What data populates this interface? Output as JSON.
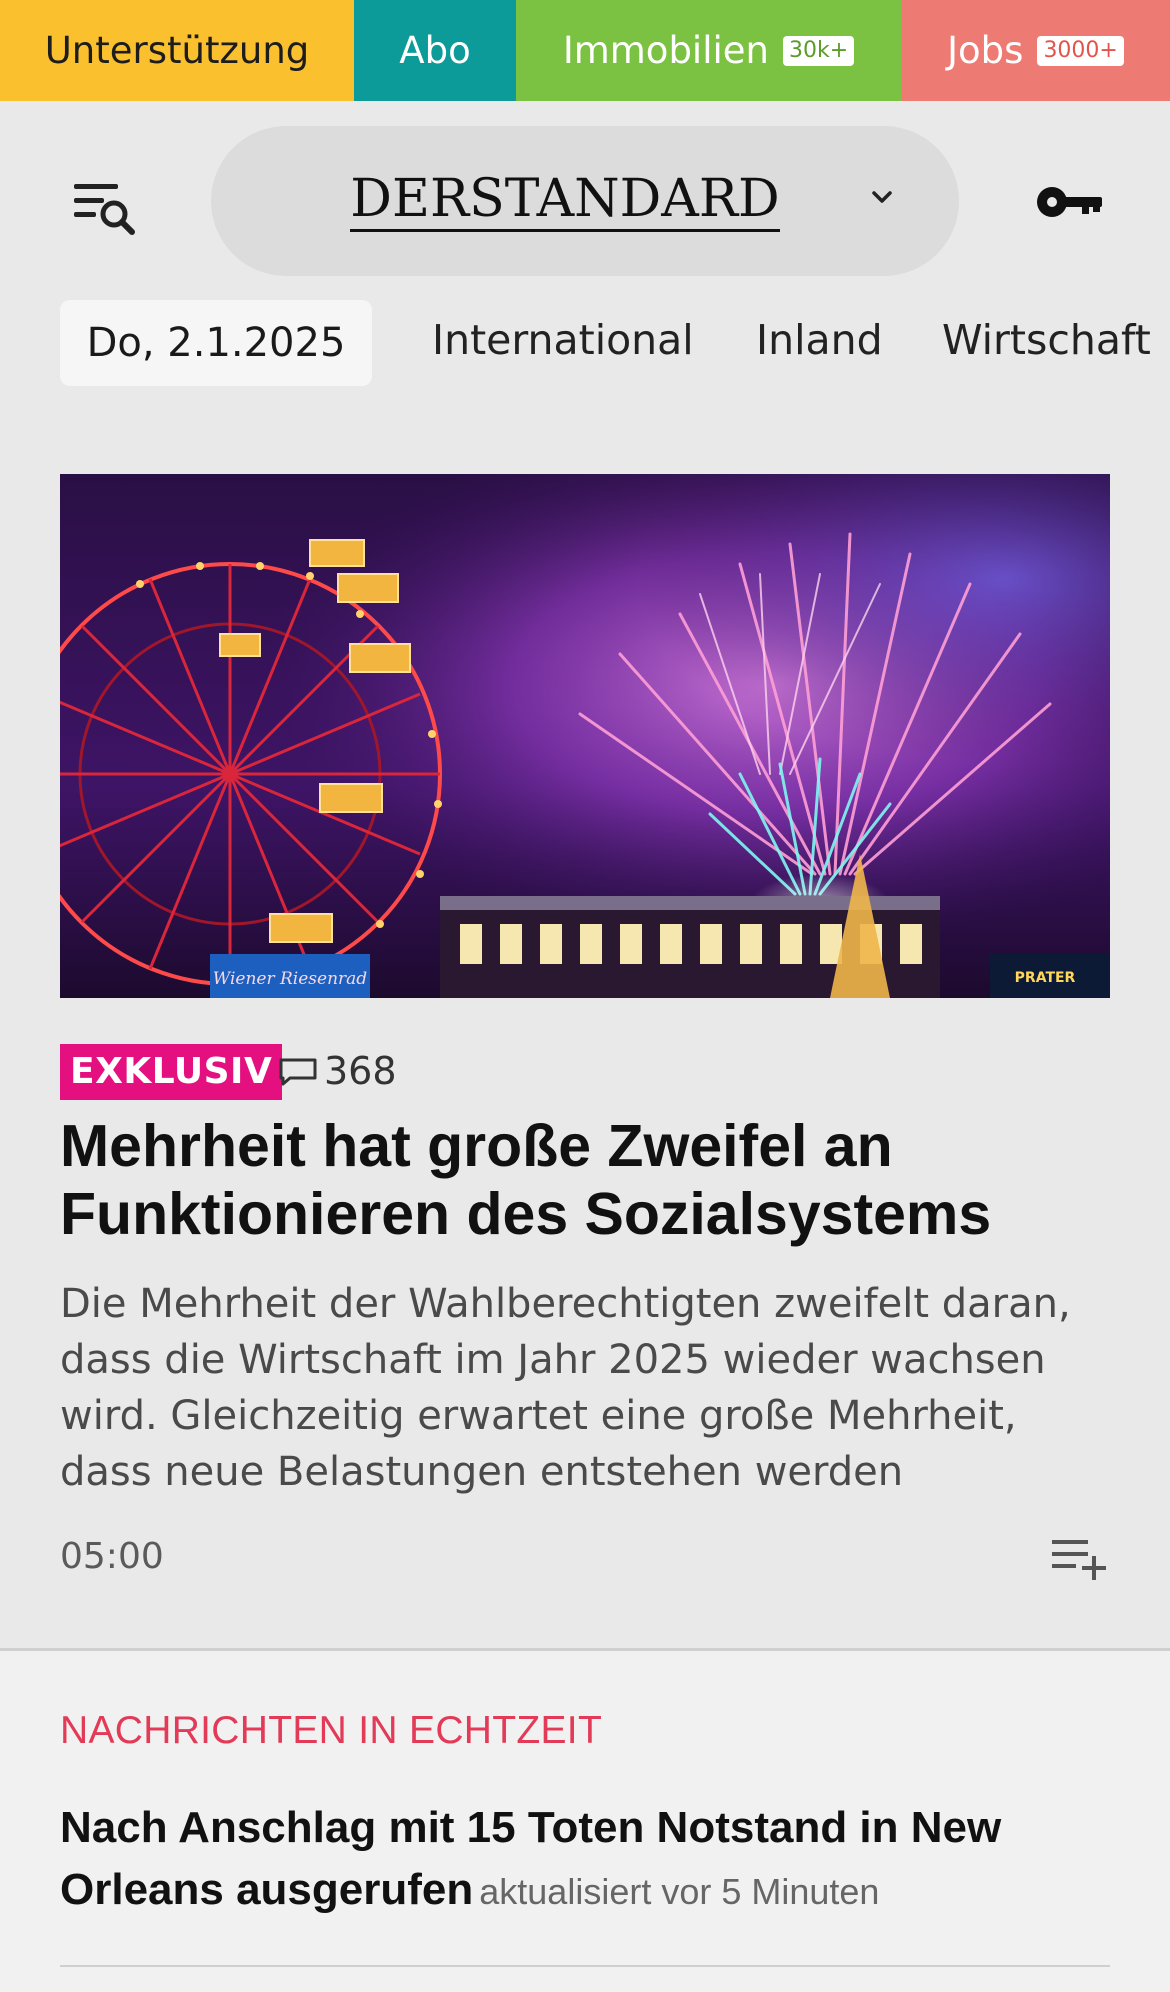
{
  "service_bar": {
    "support": "Unterstützung",
    "abo": "Abo",
    "immobilien": "Immobilien",
    "immobilien_badge": "30k+",
    "jobs": "Jobs",
    "jobs_badge": "3000+"
  },
  "header": {
    "logo": "DERSTANDARD"
  },
  "nav": {
    "date": "Do, 2.1.2025",
    "items": [
      "International",
      "Inland",
      "Wirtschaft"
    ]
  },
  "lead_article": {
    "tag": "EXKLUSIV",
    "comment_count": "368",
    "headline": "Mehrheit hat große Zweifel an Funktionieren des Sozialsystems",
    "teaser": "Die Mehrheit der Wahlberechtigten zweifelt daran, dass die Wirtschaft im Jahr 2025 wieder wachsen wird. Gleichzeitig erwartet eine große Mehrheit, dass neue Belastungen entstehen werden",
    "time": "05:00",
    "image_signs": [
      "Wiener Riesenrad",
      "PRATER"
    ]
  },
  "realtime": {
    "label": "NACHRICHTEN IN ECHTZEIT",
    "headline": "Nach Anschlag mit 15 Toten Notstand in New Orleans ausgerufen",
    "updated": "aktualisiert vor 5 Minuten"
  },
  "colors": {
    "support": "#fbc02d",
    "abo": "#0d9b99",
    "immobilien": "#7cc242",
    "jobs": "#ee7b73",
    "exklusiv_tag": "#e4107f",
    "realtime_label": "#e23a57"
  }
}
